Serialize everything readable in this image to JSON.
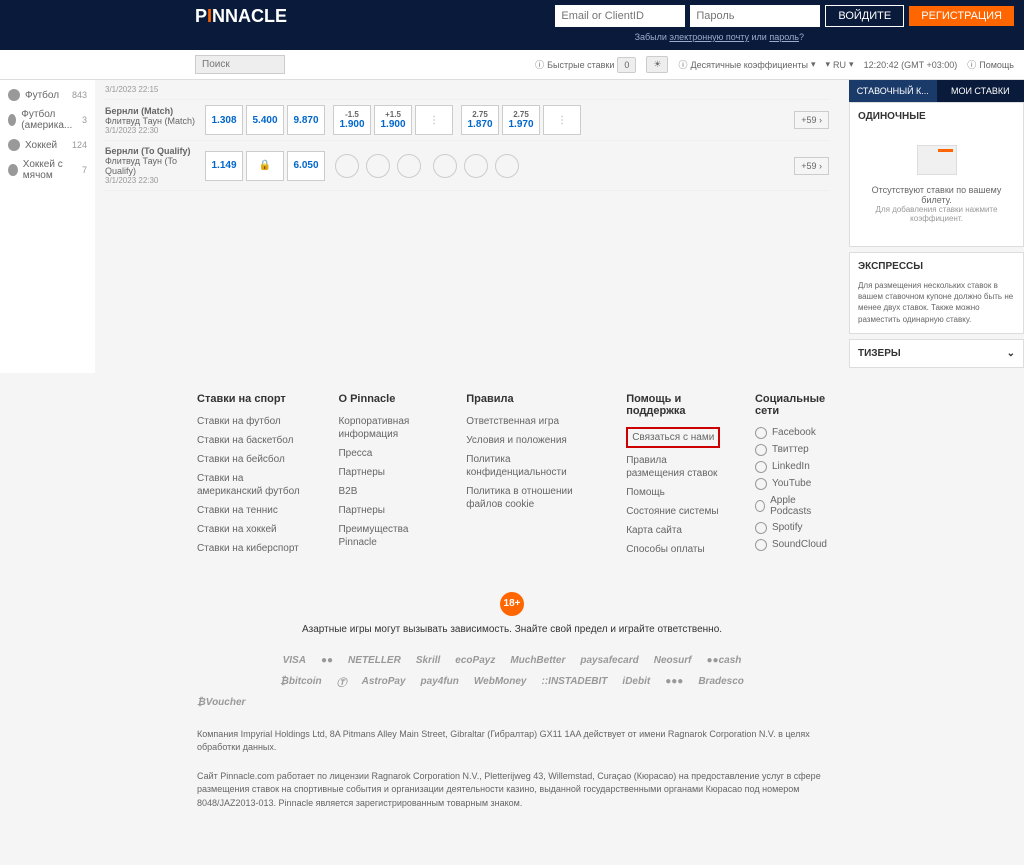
{
  "header": {
    "logo_main": "PINNACLE",
    "email_placeholder": "Email or ClientID",
    "password_placeholder": "Пароль",
    "login_btn": "ВОЙДИТЕ",
    "register_btn": "РЕГИСТРАЦИЯ",
    "forgot_prefix": "Забыли ",
    "forgot_email": "электронную почту",
    "forgot_mid": " или ",
    "forgot_password": "пароль",
    "forgot_suffix": "?"
  },
  "toolbar": {
    "search_placeholder": "Поиск",
    "quick_bets": "Быстрые ставки",
    "quick_val": "0",
    "odds": "Десятичные коэффициенты",
    "lang": "RU",
    "time": "12:20:42 (GMT +03:00)",
    "help": "Помощь"
  },
  "sidebar": {
    "items": [
      {
        "label": "Футбол",
        "count": "843"
      },
      {
        "label": "Футбол (америка...",
        "count": "3"
      },
      {
        "label": "Хоккей",
        "count": "124"
      },
      {
        "label": "Хоккей с мячом",
        "count": "7"
      }
    ]
  },
  "matches": [
    {
      "date": "3/1/2023 22:15",
      "name": "",
      "sub": "",
      "odds": []
    },
    {
      "name": "Бернли (Match)",
      "sub": "Флитвуд Таун (Match)",
      "date": "3/1/2023 22:30",
      "odds": [
        "1.308",
        "5.400",
        "9.870"
      ],
      "spreads": [
        {
          "s": "-1.5",
          "o": "1.900"
        },
        {
          "s": "+1.5",
          "o": "1.900"
        }
      ],
      "totals": [
        {
          "s": "2.75",
          "o": "1.870"
        },
        {
          "s": "2.75",
          "o": "1.970"
        }
      ],
      "more": "+59"
    },
    {
      "name": "Бернли (To Qualify)",
      "sub": "Флитвуд Таун (To Qualify)",
      "date": "3/1/2023 22:30",
      "odds": [
        "1.149",
        "",
        "6.050"
      ],
      "more": "+59"
    }
  ],
  "betslip": {
    "tab1": "СТАВОЧНЫЙ К...",
    "tab2": "МОИ СТАВКИ",
    "singles_title": "ОДИНОЧНЫЕ",
    "empty_title": "Отсутствуют ставки по вашему билету.",
    "empty_sub": "Для добавления ставки нажмите коэффициент.",
    "express_title": "ЭКСПРЕССЫ",
    "express_text": "Для размещения нескольких ставок в вашем ставочном купоне должно быть не менее двух ставок. Также можно разместить одинарную ставку.",
    "teasers_title": "ТИЗЕРЫ"
  },
  "footer": {
    "col1_title": "Ставки на спорт",
    "col1": [
      "Ставки на футбол",
      "Ставки на баскетбол",
      "Ставки на бейсбол",
      "Ставки на американский футбол",
      "Ставки на теннис",
      "Ставки на хоккей",
      "Ставки на киберспорт"
    ],
    "col2_title": "О Pinnacle",
    "col2": [
      "Корпоративная информация",
      "Пресса",
      "Партнеры",
      "B2B",
      "Партнеры",
      "Преимущества Pinnacle"
    ],
    "col3_title": "Правила",
    "col3": [
      "Ответственная игра",
      "Условия и положения",
      "Политика конфиденциальности",
      "Политика в отношении файлов cookie"
    ],
    "col4_title": "Помощь и поддержка",
    "col4_highlighted": "Связаться с нами",
    "col4": [
      "Правила размещения ставок",
      "Помощь",
      "Состояние системы",
      "Карта сайта",
      "Способы оплаты"
    ],
    "col5_title": "Социальные сети",
    "socials": [
      "Facebook",
      "Твиттер",
      "LinkedIn",
      "YouTube",
      "Apple Podcasts",
      "Spotify",
      "SoundCloud"
    ],
    "age": "18+",
    "warning": "Азартные игры могут вызывать зависимость. Знайте свой предел и играйте ответственно.",
    "payments1": [
      "VISA",
      "●●",
      "NETELLER",
      "Skrill",
      "ecoPayz",
      "MuchBetter",
      "paysafecard",
      "Neosurf",
      "●●cash"
    ],
    "payments2": [
      "₿bitcoin",
      "Ⓣ",
      "AstroPay",
      "pay4fun",
      "WebMoney",
      "::INSTADEBIT",
      "iDebit",
      "●●●",
      "Bradesco"
    ],
    "payments3": [
      "₿Voucher"
    ],
    "legal1": "Компания Impyrial Holdings Ltd, 8A Pitmans Alley Main Street, Gibraltar (Гибралтар) GX11 1AA действует от имени Ragnarok Corporation N.V. в целях обработки данных.",
    "legal2": "Сайт Pinnacle.com работает по лицензии Ragnarok Corporation N.V., Pletterijweg 43, Willemstad, Curaçao (Кюрасао) на предоставление услуг в сфере размещения ставок на спортивные события и организации деятельности казино, выданной государственными органами Кюрасао под номером 8048/JAZ2013-013. Pinnacle является зарегистрированным товарным знаком."
  }
}
